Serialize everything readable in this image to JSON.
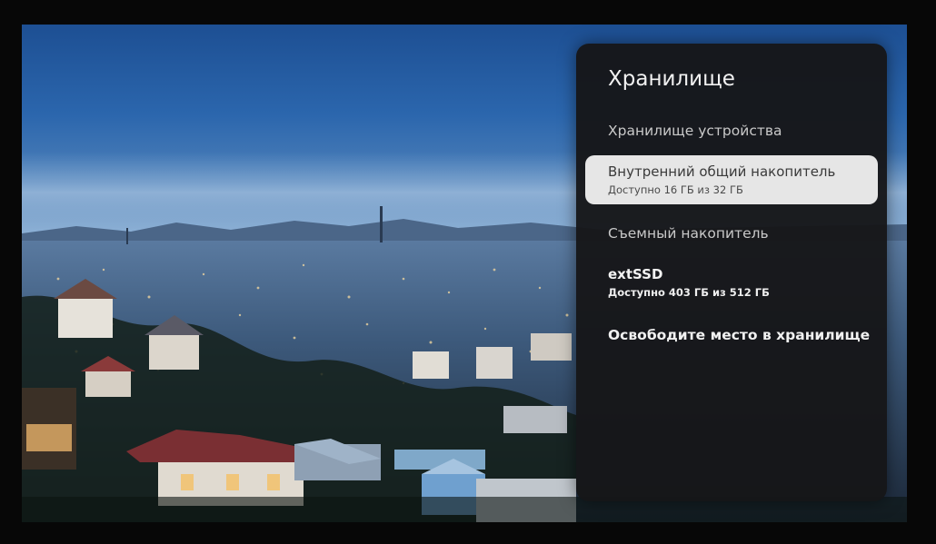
{
  "screen": {
    "title": "Хранилище",
    "sections": [
      {
        "label": "Хранилище устройства",
        "items": [
          {
            "title": "Внутренний общий накопитель",
            "subtitle": "Доступно 16 ГБ из 32 ГБ",
            "focused": true
          }
        ]
      },
      {
        "label": "Съемный накопитель",
        "items": [
          {
            "title": "extSSD",
            "subtitle": "Доступно 403 ГБ из 512 ГБ",
            "focused": false
          }
        ]
      }
    ],
    "action_label": "Освободите место в хранилище"
  },
  "colors": {
    "panel_background": "#161618",
    "focused_item": "#e6e6e6",
    "text_primary": "#f1f1f1"
  }
}
